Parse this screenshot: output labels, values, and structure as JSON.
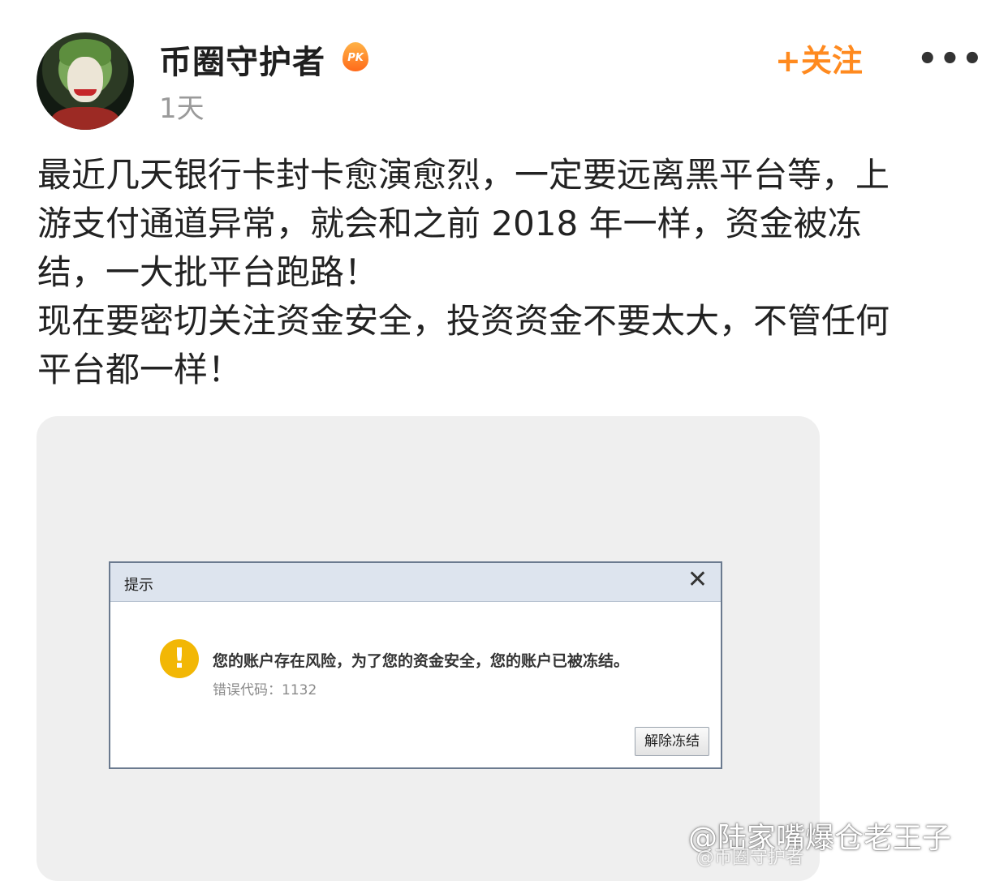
{
  "author": {
    "name": "币圈守护者",
    "badge": "PK",
    "time": "1天"
  },
  "actions": {
    "follow_label": "+关注",
    "more_label": "•••"
  },
  "post": {
    "text": "最近几天银行卡封卡愈演愈烈，一定要远离黑平台等，上\n游支付通道异常，就会和之前 2018 年一样，资金被冻\n结，一大批平台跑路！\n现在要密切关注资金安全，投资资金不要太大，不管任何\n平台都一样！"
  },
  "dialog": {
    "title": "提示",
    "close_label": "✕",
    "icon_label": "!",
    "message": "您的账户存在风险，为了您的资金安全，您的账户已被冻结。",
    "error_code": "错误代码：1132",
    "button_label": "解除冻结"
  },
  "watermark": {
    "main": "@陆家嘴爆仓老王子",
    "sub": "@币圈守护者"
  },
  "colors": {
    "follow": "#ff8a1f",
    "warning": "#f2b705",
    "dialog_header": "#dde4ee"
  }
}
